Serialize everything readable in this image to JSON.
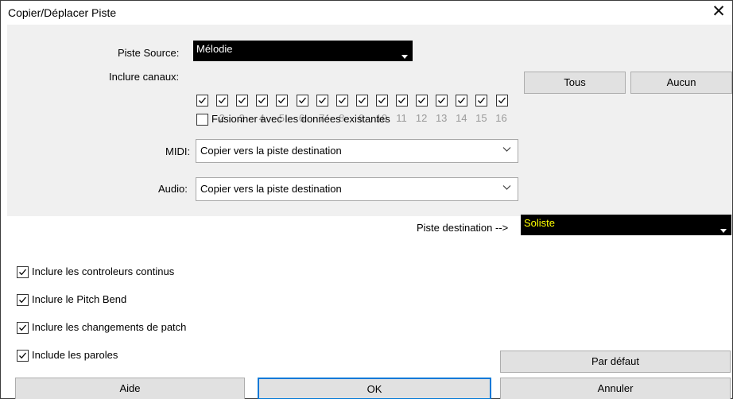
{
  "dialog": {
    "title": "Copier/Déplacer Piste",
    "close_glyph": "✕"
  },
  "source": {
    "label": "Piste Source:",
    "value": "Mélodie"
  },
  "channels": {
    "label": "Inclure canaux:",
    "numbers": [
      "1",
      "2",
      "3",
      "4",
      "5",
      "6",
      "7",
      "8",
      "9",
      "10",
      "11",
      "12",
      "13",
      "14",
      "15",
      "16"
    ],
    "all_checked": true,
    "all_button": "Tous",
    "none_button": "Aucun"
  },
  "merge": {
    "label": "Fusionner avec les données existantes",
    "checked": false
  },
  "midi": {
    "label": "MIDI:",
    "value": "Copier vers la piste destination"
  },
  "audio": {
    "label": "Audio:",
    "value": "Copier vers la piste destination"
  },
  "destination": {
    "label": "Piste destination -->",
    "value": "Soliste",
    "value_color": "#ffff00"
  },
  "options": [
    {
      "label": "Inclure les controleurs continus",
      "checked": true
    },
    {
      "label": "Inclure le Pitch Bend",
      "checked": true
    },
    {
      "label": "Inclure les changements de patch",
      "checked": true
    },
    {
      "label": "Include les paroles",
      "checked": true
    }
  ],
  "buttons": {
    "default": "Par défaut",
    "help": "Aide",
    "ok": "OK",
    "cancel": "Annuler"
  },
  "colors": {
    "panel_bg": "#f0f0f0",
    "button_bg": "#e1e1e1",
    "ok_border": "#0078d7",
    "dark_select_bg": "#000000"
  }
}
